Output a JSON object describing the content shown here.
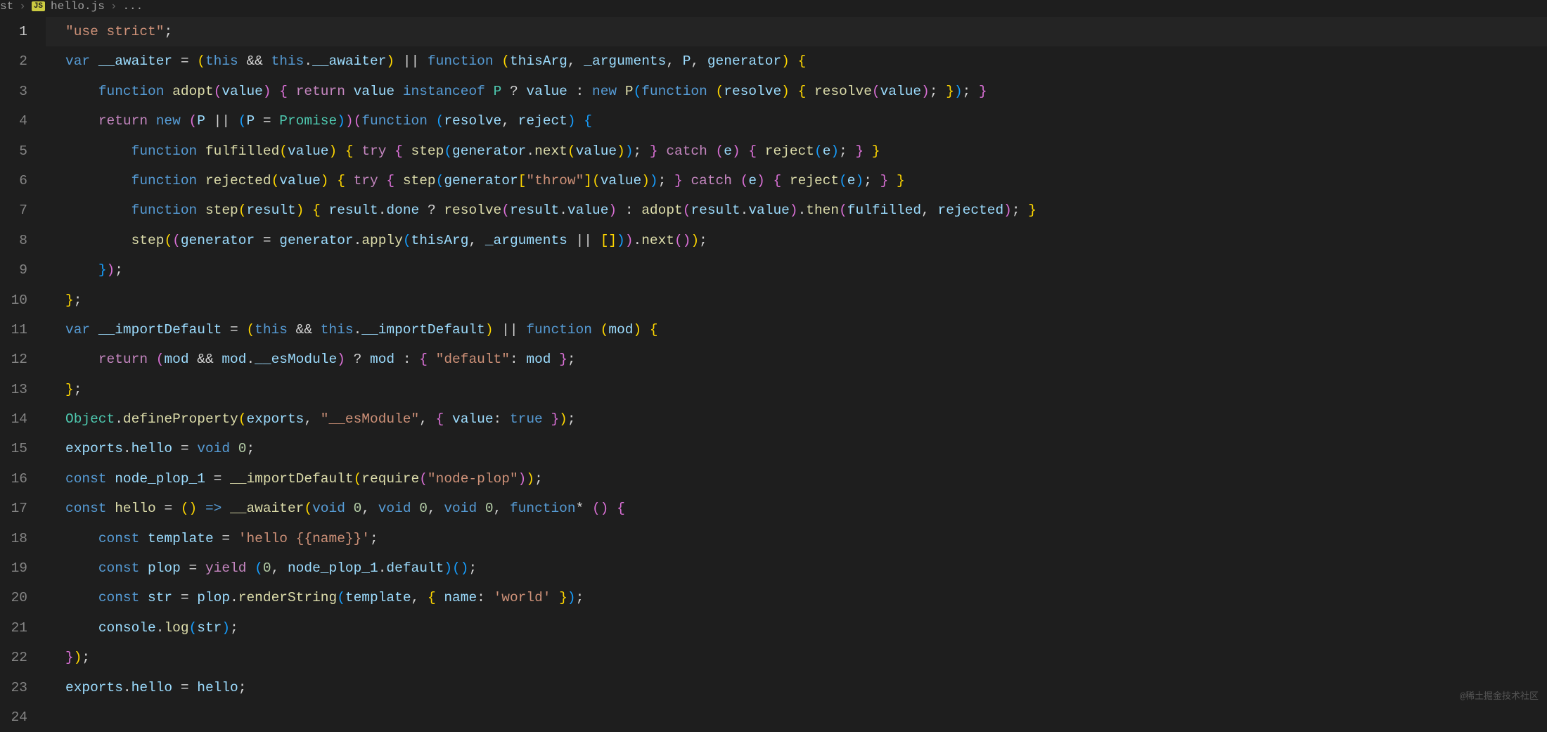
{
  "breadcrumb": {
    "folder": "st",
    "file_icon": "JS",
    "file": "hello.js",
    "trail": "..."
  },
  "line_numbers": [
    "1",
    "2",
    "3",
    "4",
    "5",
    "6",
    "7",
    "8",
    "9",
    "10",
    "11",
    "12",
    "13",
    "14",
    "15",
    "16",
    "17",
    "18",
    "19",
    "20",
    "21",
    "22",
    "23",
    "24"
  ],
  "code_plain": [
    "\"use strict\";",
    "var __awaiter = (this && this.__awaiter) || function (thisArg, _arguments, P, generator) {",
    "    function adopt(value) { return value instanceof P ? value : new P(function (resolve) { resolve(value); }); }",
    "    return new (P || (P = Promise))(function (resolve, reject) {",
    "        function fulfilled(value) { try { step(generator.next(value)); } catch (e) { reject(e); } }",
    "        function rejected(value) { try { step(generator[\"throw\"](value)); } catch (e) { reject(e); } }",
    "        function step(result) { result.done ? resolve(result.value) : adopt(result.value).then(fulfilled, rejected); }",
    "        step((generator = generator.apply(thisArg, _arguments || [])).next());",
    "    });",
    "};",
    "var __importDefault = (this && this.__importDefault) || function (mod) {",
    "    return (mod && mod.__esModule) ? mod : { \"default\": mod };",
    "};",
    "Object.defineProperty(exports, \"__esModule\", { value: true });",
    "exports.hello = void 0;",
    "const node_plop_1 = __importDefault(require(\"node-plop\"));",
    "const hello = () => __awaiter(void 0, void 0, void 0, function* () {",
    "    const template = 'hello {{name}}';",
    "    const plop = yield (0, node_plop_1.default)();",
    "    const str = plop.renderString(template, { name: 'world' });",
    "    console.log(str);",
    "});",
    "exports.hello = hello;",
    ""
  ],
  "watermark": "@稀土掘金技术社区",
  "active_line": 1
}
